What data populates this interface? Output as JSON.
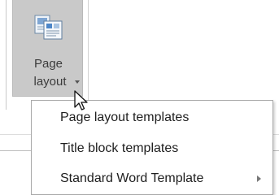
{
  "ribbon": {
    "button_label_line1": "Page",
    "button_label_line2": "layout",
    "icon": "page-layout-icon"
  },
  "menu": {
    "items": [
      {
        "label": "Page layout templates"
      },
      {
        "label": "Title block templates"
      },
      {
        "label": "Standard Word Template",
        "has_submenu": true
      }
    ]
  },
  "colors": {
    "button_hover_bg": "#c9c9c9",
    "menu_bg": "#ffffff",
    "menu_border": "#a9a9a9",
    "text": "#1e1e1e"
  }
}
